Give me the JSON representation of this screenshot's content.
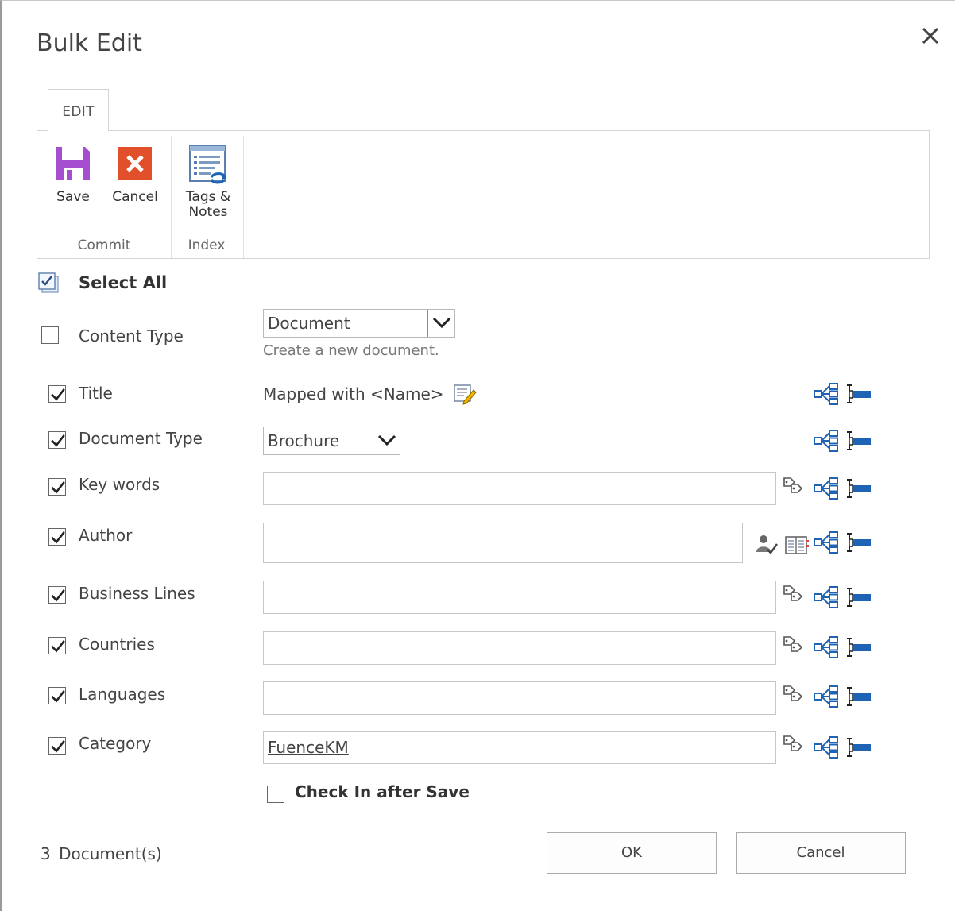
{
  "dialog": {
    "title": "Bulk Edit"
  },
  "ribbon": {
    "tab_label": "EDIT",
    "save_label": "Save",
    "cancel_label": "Cancel",
    "tags_notes_label_1": "Tags &",
    "tags_notes_label_2": "Notes",
    "group_commit": "Commit",
    "group_index": "Index"
  },
  "form": {
    "select_all_label": "Select All",
    "content_type": {
      "label": "Content Type",
      "value": "Document",
      "description": "Create a new document.",
      "checked": false
    },
    "fields": [
      {
        "label": "Title",
        "mapped_text": "Mapped with <Name>",
        "checked": true
      },
      {
        "label": "Document Type",
        "value": "Brochure",
        "checked": true
      },
      {
        "label": "Key words",
        "value": "",
        "checked": true
      },
      {
        "label": "Author",
        "value": "",
        "checked": true
      },
      {
        "label": "Business Lines",
        "value": "",
        "checked": true
      },
      {
        "label": "Countries",
        "value": "",
        "checked": true
      },
      {
        "label": "Languages",
        "value": "",
        "checked": true
      },
      {
        "label": "Category",
        "value": "FuenceKM",
        "checked": true
      }
    ],
    "check_in_label": "Check In after Save",
    "check_in_checked": false
  },
  "footer": {
    "doc_count": "3",
    "doc_count_label": "Document(s)",
    "ok_label": "OK",
    "cancel_label": "Cancel"
  },
  "colors": {
    "save_icon": "#a54fd0",
    "cancel_icon": "#e24f2b",
    "tree_icon": "#1f63b5",
    "column_icon": "#1f63b5"
  }
}
